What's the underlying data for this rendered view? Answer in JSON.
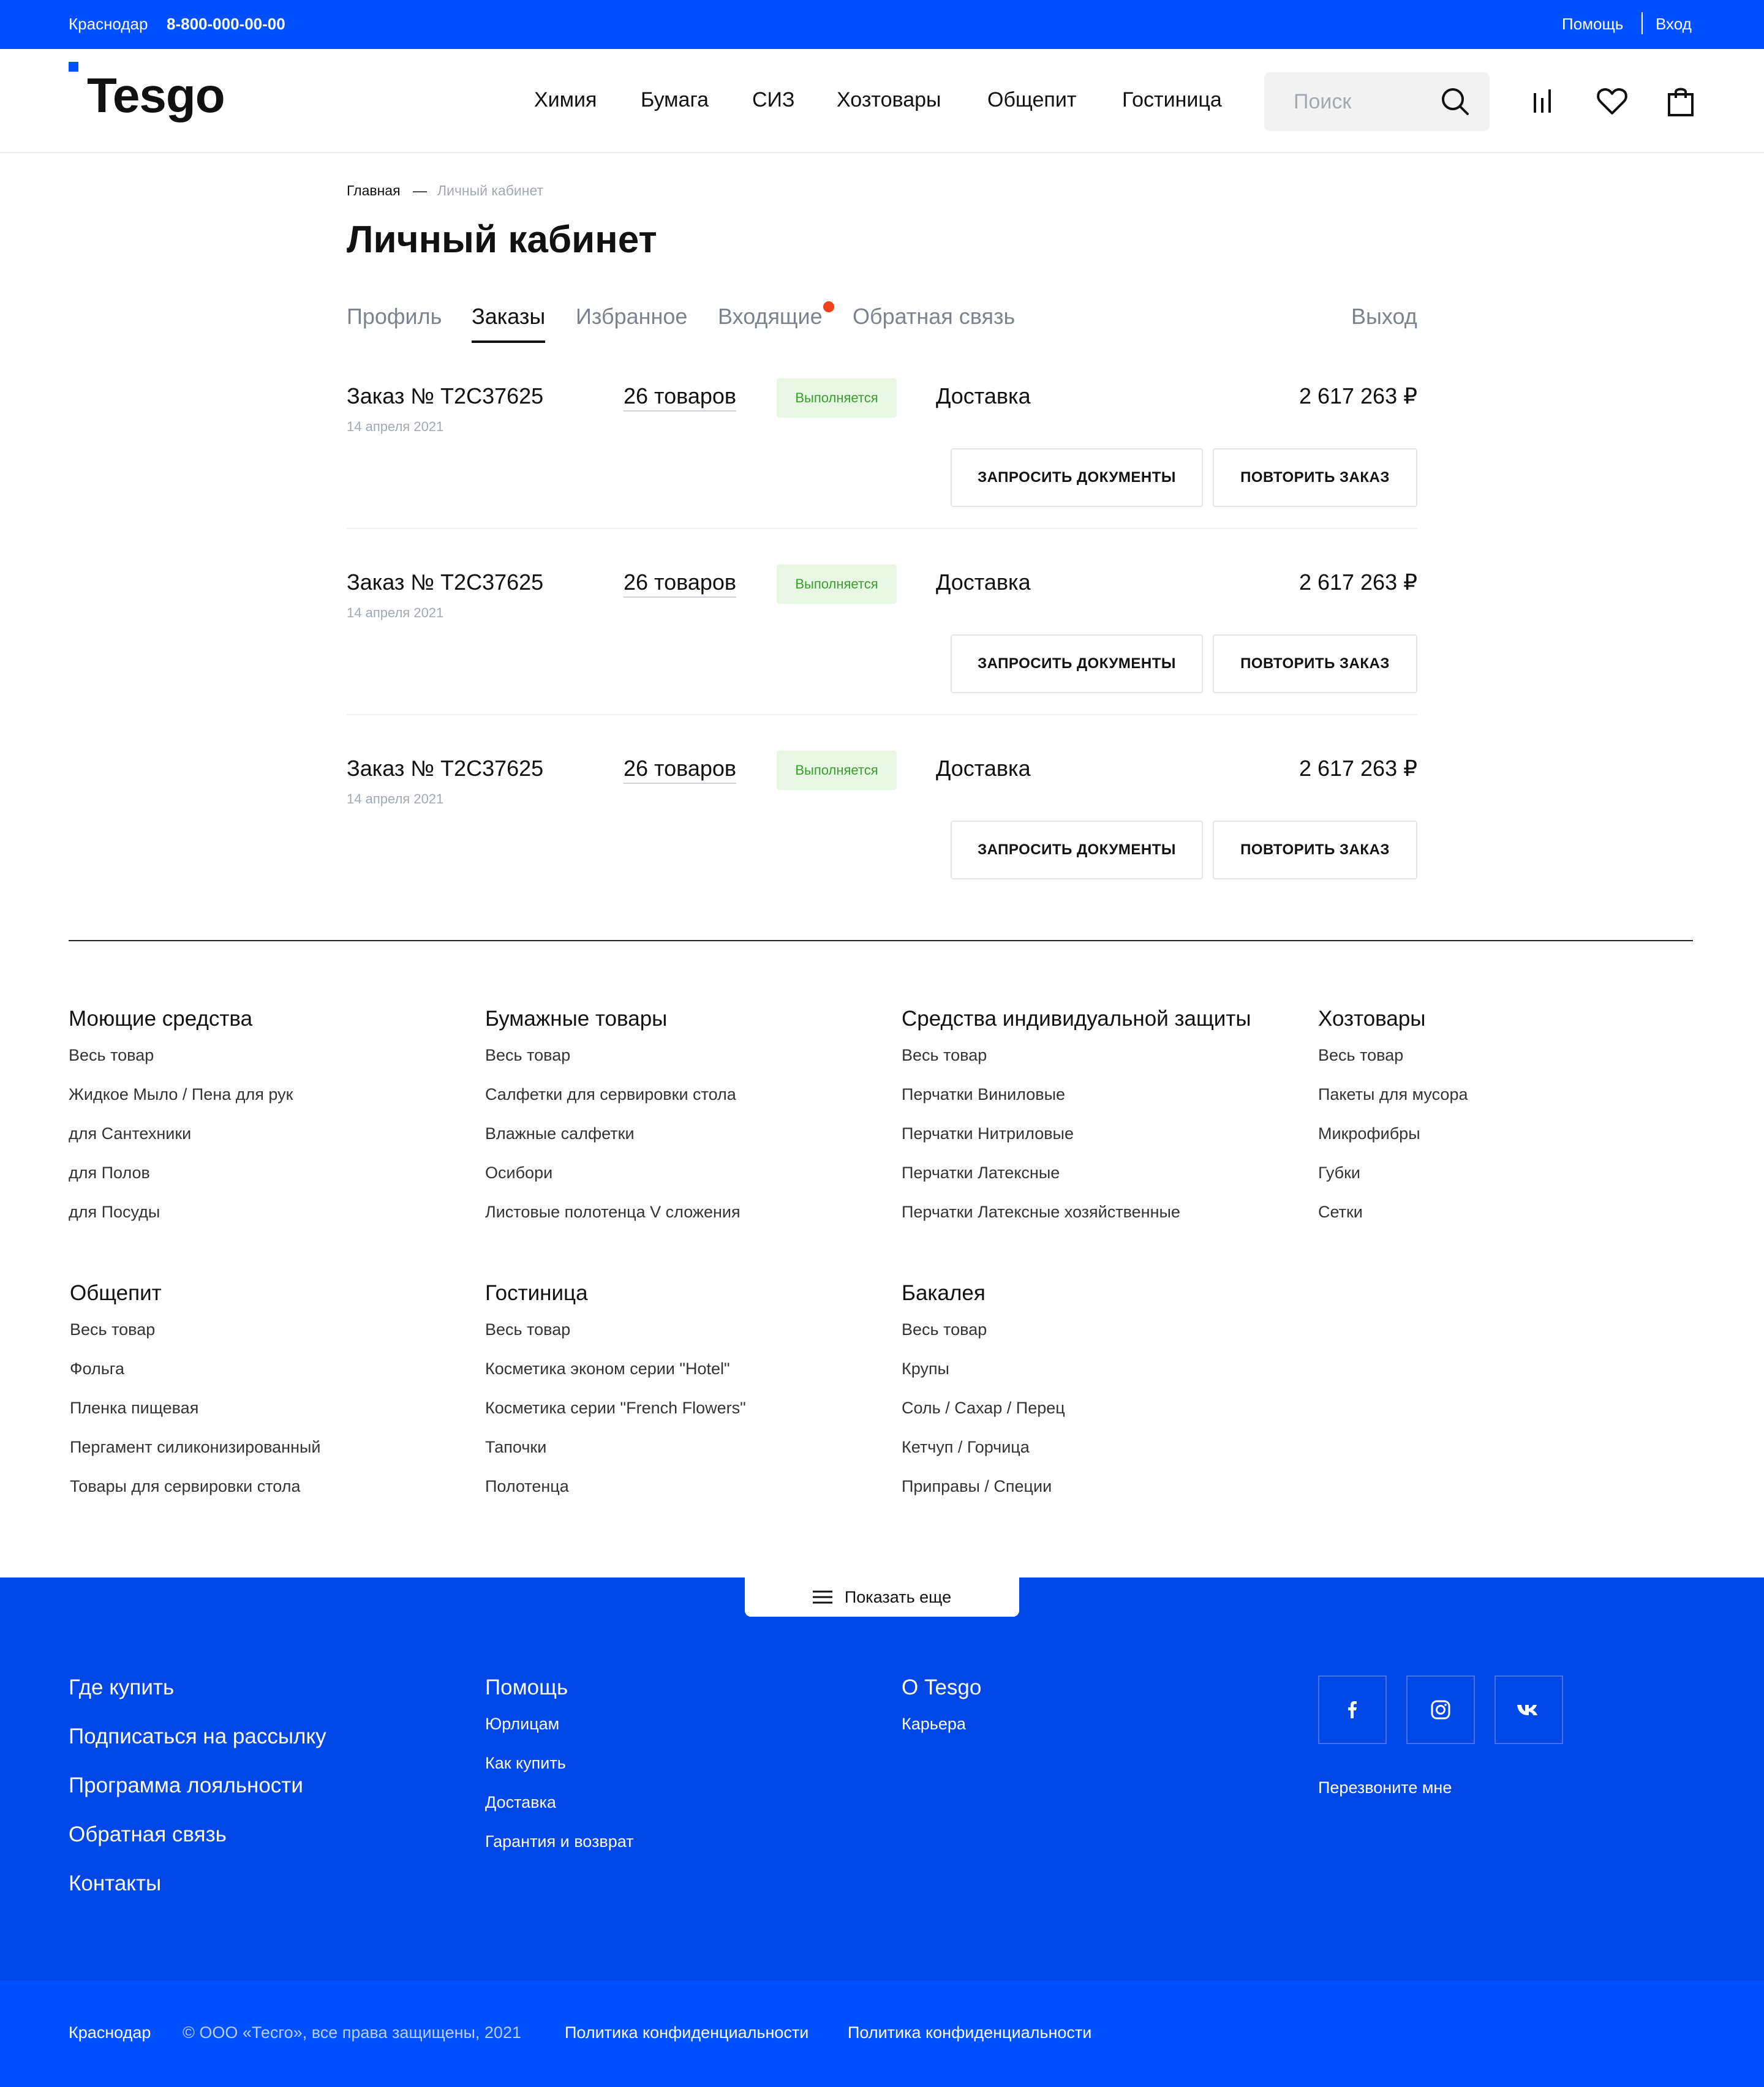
{
  "topbar": {
    "city": "Краснодар",
    "phone": "8-800-000-00-00",
    "help": "Помощь",
    "login": "Вход"
  },
  "header": {
    "logo": "Tesgo",
    "nav": [
      "Химия",
      "Бумага",
      "СИЗ",
      "Хозтовары",
      "Общепит",
      "Гостиница"
    ],
    "search_placeholder": "Поиск",
    "icons": [
      "search-icon",
      "compare-icon",
      "heart-icon",
      "bag-icon"
    ]
  },
  "breadcrumb": {
    "home": "Главная",
    "separator": "—",
    "current": "Личный кабинет"
  },
  "page_title": "Личный кабинет",
  "tabs": [
    {
      "label": "Профиль",
      "active": false
    },
    {
      "label": "Заказы",
      "active": true
    },
    {
      "label": "Избранное",
      "active": false
    },
    {
      "label": "Входящие",
      "active": false,
      "notification": true
    },
    {
      "label": "Обратная связь",
      "active": false
    }
  ],
  "logout": "Выход",
  "orders": [
    {
      "id": "Заказ № T2C37625",
      "date": "14 апреля 2021",
      "items": "26 товаров",
      "status": "Выполняется",
      "delivery": "Доставка",
      "price": "2 617 263 ₽",
      "btn_docs": "ЗАПРОСИТЬ ДОКУМЕНТЫ",
      "btn_repeat": "ПОВТОРИТЬ ЗАКАЗ"
    },
    {
      "id": "Заказ № T2C37625",
      "date": "14 апреля 2021",
      "items": "26 товаров",
      "status": "Выполняется",
      "delivery": "Доставка",
      "price": "2 617 263 ₽",
      "btn_docs": "ЗАПРОСИТЬ ДОКУМЕНТЫ",
      "btn_repeat": "ПОВТОРИТЬ ЗАКАЗ"
    },
    {
      "id": "Заказ № T2C37625",
      "date": "14 апреля 2021",
      "items": "26 товаров",
      "status": "Выполняется",
      "delivery": "Доставка",
      "price": "2 617 263 ₽",
      "btn_docs": "ЗАПРОСИТЬ ДОКУМЕНТЫ",
      "btn_repeat": "ПОВТОРИТЬ ЗАКАЗ"
    }
  ],
  "catalog": [
    {
      "title": "Моющие средства",
      "links": [
        "Весь товар",
        "Жидкое Мыло / Пена для рук",
        "для Сантехники",
        "для Полов",
        "для Посуды"
      ]
    },
    {
      "title": "Бумажные товары",
      "links": [
        "Весь товар",
        "Салфетки для сервировки стола",
        "Влажные салфетки",
        "Осибори",
        "Листовые полотенца V сложения"
      ]
    },
    {
      "title": "Средства индивидуальной защиты",
      "links": [
        "Весь товар",
        "Перчатки Виниловые",
        "Перчатки Нитриловые",
        "Перчатки Латексные",
        "Перчатки Латексные хозяйственные"
      ]
    },
    {
      "title": "Хозтовары",
      "links": [
        "Весь товар",
        "Пакеты для мусора",
        "Микрофибры",
        "Губки",
        "Сетки"
      ]
    },
    {
      "title": "Общепит",
      "links": [
        "Весь товар",
        "Фольга",
        "Пленка пищевая",
        "Пергамент силиконизированный",
        "Товары для сервировки стола"
      ]
    },
    {
      "title": "Гостиница",
      "links": [
        "Весь товар",
        "Косметика эконом серии \"Hotel\"",
        "Косметика серии \"French Flowers\"",
        "Тапочки",
        "Полотенца"
      ]
    },
    {
      "title": "Бакалея",
      "links": [
        "Весь товар",
        "Крупы",
        "Соль / Сахар / Перец",
        "Кетчуп / Горчица",
        "Приправы / Специи"
      ]
    }
  ],
  "show_more": "Показать еще",
  "footer": {
    "main_links": [
      "Где купить",
      "Подписаться на рассылку",
      "Программа лояльности",
      "Обратная связь",
      "Контакты"
    ],
    "help": {
      "title": "Помощь",
      "links": [
        "Юрлицам",
        "Как купить",
        "Доставка",
        "Гарантия и возврат"
      ]
    },
    "about": {
      "title": "О Tesgo",
      "links": [
        "Карьера"
      ]
    },
    "social": [
      "facebook-icon",
      "instagram-icon",
      "vk-icon"
    ],
    "callback": "Перезвоните мне"
  },
  "bottom": {
    "city": "Краснодар",
    "copyright": "© ООО «Тесго», все права защищены, 2021",
    "privacy_1": "Политика конфиденциальности",
    "privacy_2": "Политика конфиденциальности"
  },
  "colors": {
    "brand": "#0050FF",
    "footer": "#0047E6",
    "status_bg": "#E8F7E4",
    "status_text": "#36A02A",
    "notification": "#F04418"
  }
}
